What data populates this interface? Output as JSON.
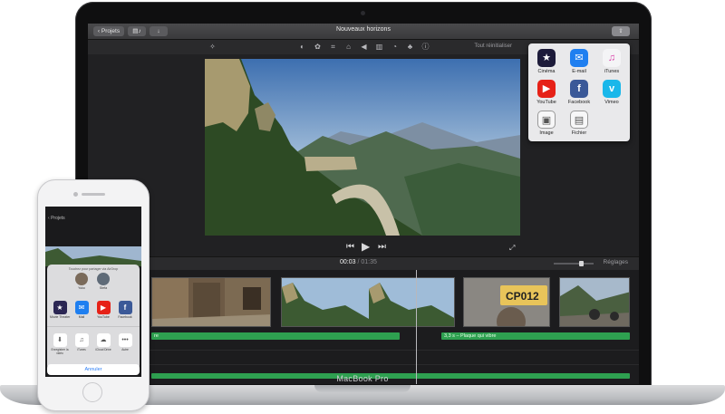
{
  "macbook": {
    "label": "MacBook Pro"
  },
  "imovie": {
    "title": "Nouveaux horizons",
    "projects_label": "Projets",
    "reset_label": "Tout réinitialiser",
    "timecode_current": "00:03",
    "timecode_sep": "/",
    "timecode_total": "01:35",
    "settings_label": "Réglages",
    "zoom_fraction": 0.7,
    "audio_clips": [
      {
        "label": "re"
      },
      {
        "label": "3,3 s – Plaque qui vibre"
      }
    ]
  },
  "share_menu": {
    "items": [
      {
        "label": "Cinéma",
        "glyph": "★",
        "color": "#1d1b3a",
        "icon": "cinema-star-icon"
      },
      {
        "label": "E-mail",
        "glyph": "✉",
        "color": "#1f7ff0",
        "icon": "mail-icon"
      },
      {
        "label": "iTunes",
        "glyph": "♫",
        "color": "#f4f4f6",
        "icon": "itunes-icon"
      },
      {
        "label": "YouTube",
        "glyph": "▶",
        "color": "#e62117",
        "icon": "youtube-icon"
      },
      {
        "label": "Facebook",
        "glyph": "f",
        "color": "#3b5998",
        "icon": "facebook-icon"
      },
      {
        "label": "Vimeo",
        "glyph": "v",
        "color": "#1ab7ea",
        "icon": "vimeo-icon"
      },
      {
        "label": "Image",
        "glyph": "▣",
        "color": "#f7f7f8",
        "icon": "image-icon"
      },
      {
        "label": "Fichier",
        "glyph": "▤",
        "color": "#f7f7f8",
        "icon": "file-film-icon"
      }
    ]
  },
  "iphone": {
    "back_label": "Projets",
    "airdrop_text": "Touchez pour partager via AirDrop",
    "people": [
      {
        "name": "Yuko"
      },
      {
        "name": "Stefa"
      }
    ],
    "apps": [
      {
        "label": "Movie Theater",
        "glyph": "★",
        "color": "#2b2653"
      },
      {
        "label": "Mail",
        "glyph": "✉",
        "color": "#1f7ff0"
      },
      {
        "label": "YouTube",
        "glyph": "▶",
        "color": "#e62117"
      },
      {
        "label": "Facebook",
        "glyph": "f",
        "color": "#3b5998"
      }
    ],
    "actions": [
      {
        "label": "Enregistrer la vidéo",
        "glyph": "⬇"
      },
      {
        "label": "iTunes",
        "glyph": "♫"
      },
      {
        "label": "iCloud Drive",
        "glyph": "☁"
      },
      {
        "label": "Autre",
        "glyph": "•••"
      }
    ],
    "cancel_label": "Annuler"
  }
}
